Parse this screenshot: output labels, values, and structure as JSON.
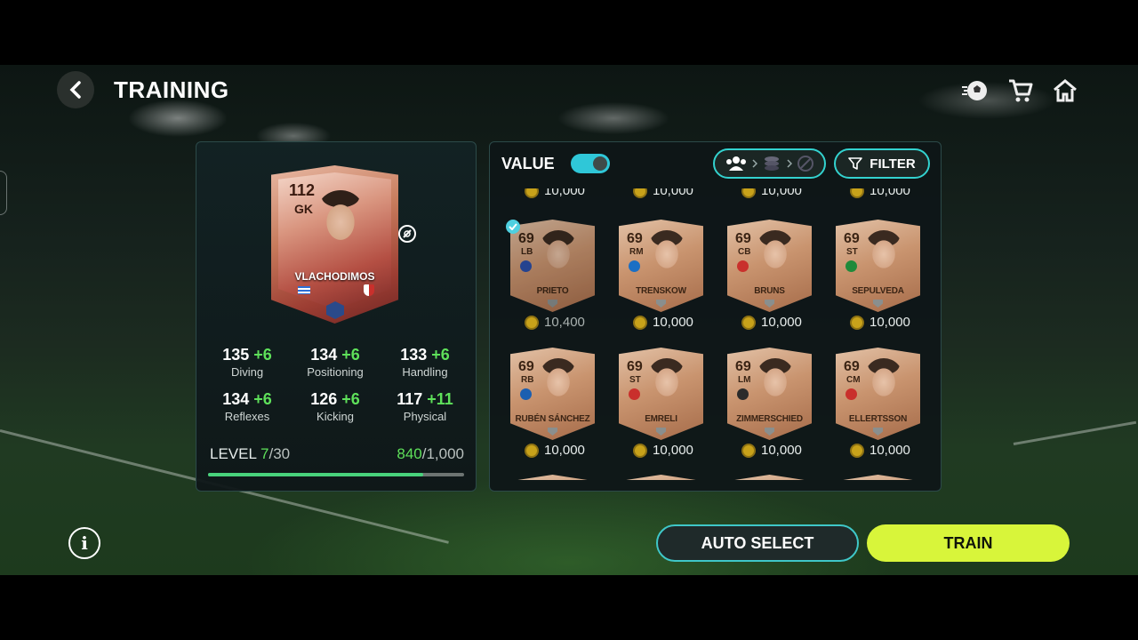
{
  "header": {
    "title": "TRAINING"
  },
  "icons": {
    "back": "back-chevron-icon",
    "ball": "ball-icon",
    "store": "cart-icon",
    "home": "home-icon"
  },
  "player": {
    "rating": "112",
    "position": "GK",
    "name": "VLACHODIMOS",
    "stats": [
      {
        "value": "135",
        "plus": "+6",
        "label": "Diving"
      },
      {
        "value": "134",
        "plus": "+6",
        "label": "Positioning"
      },
      {
        "value": "133",
        "plus": "+6",
        "label": "Handling"
      },
      {
        "value": "134",
        "plus": "+6",
        "label": "Reflexes"
      },
      {
        "value": "126",
        "plus": "+6",
        "label": "Kicking"
      },
      {
        "value": "117",
        "plus": "+11",
        "label": "Physical"
      }
    ],
    "level_label": "LEVEL",
    "level": "7",
    "level_max": "/30",
    "xp": "840",
    "xp_max": "/1,000",
    "xp_progress": 0.84
  },
  "controls": {
    "value_label": "VALUE",
    "value_toggle_on": true,
    "filter_label": "FILTER"
  },
  "cards": [
    {
      "ovr": "69",
      "pos": "LB",
      "name": "PRIETO",
      "price": "10,400",
      "selected": true,
      "badge": "#2b4fa8"
    },
    {
      "ovr": "69",
      "pos": "RM",
      "name": "TRENSKOW",
      "price": "10,000",
      "selected": false,
      "badge": "#1b6fc4"
    },
    {
      "ovr": "69",
      "pos": "CB",
      "name": "BRUNS",
      "price": "10,000",
      "selected": false,
      "badge": "#c9302c"
    },
    {
      "ovr": "69",
      "pos": "ST",
      "name": "SEPULVEDA",
      "price": "10,000",
      "selected": false,
      "badge": "#1f8a3a"
    },
    {
      "ovr": "69",
      "pos": "RB",
      "name": "RUBÉN SÁNCHEZ",
      "price": "10,000",
      "selected": false,
      "badge": "#1b5fb0"
    },
    {
      "ovr": "69",
      "pos": "ST",
      "name": "EMRELI",
      "price": "10,000",
      "selected": false,
      "badge": "#c9302c"
    },
    {
      "ovr": "69",
      "pos": "LM",
      "name": "ZIMMERSCHIED",
      "price": "10,000",
      "selected": false,
      "badge": "#2b2b2b"
    },
    {
      "ovr": "69",
      "pos": "CM",
      "name": "ELLERTSSON",
      "price": "10,000",
      "selected": false,
      "badge": "#c9302c"
    }
  ],
  "partial_prices": [
    "10,000",
    "10,000",
    "10,000",
    "10,000"
  ],
  "footer": {
    "auto_select": "AUTO SELECT",
    "train": "TRAIN"
  },
  "colors": {
    "accent": "#33d2cf",
    "train": "#d8f53a",
    "positive": "#5ee05a"
  }
}
